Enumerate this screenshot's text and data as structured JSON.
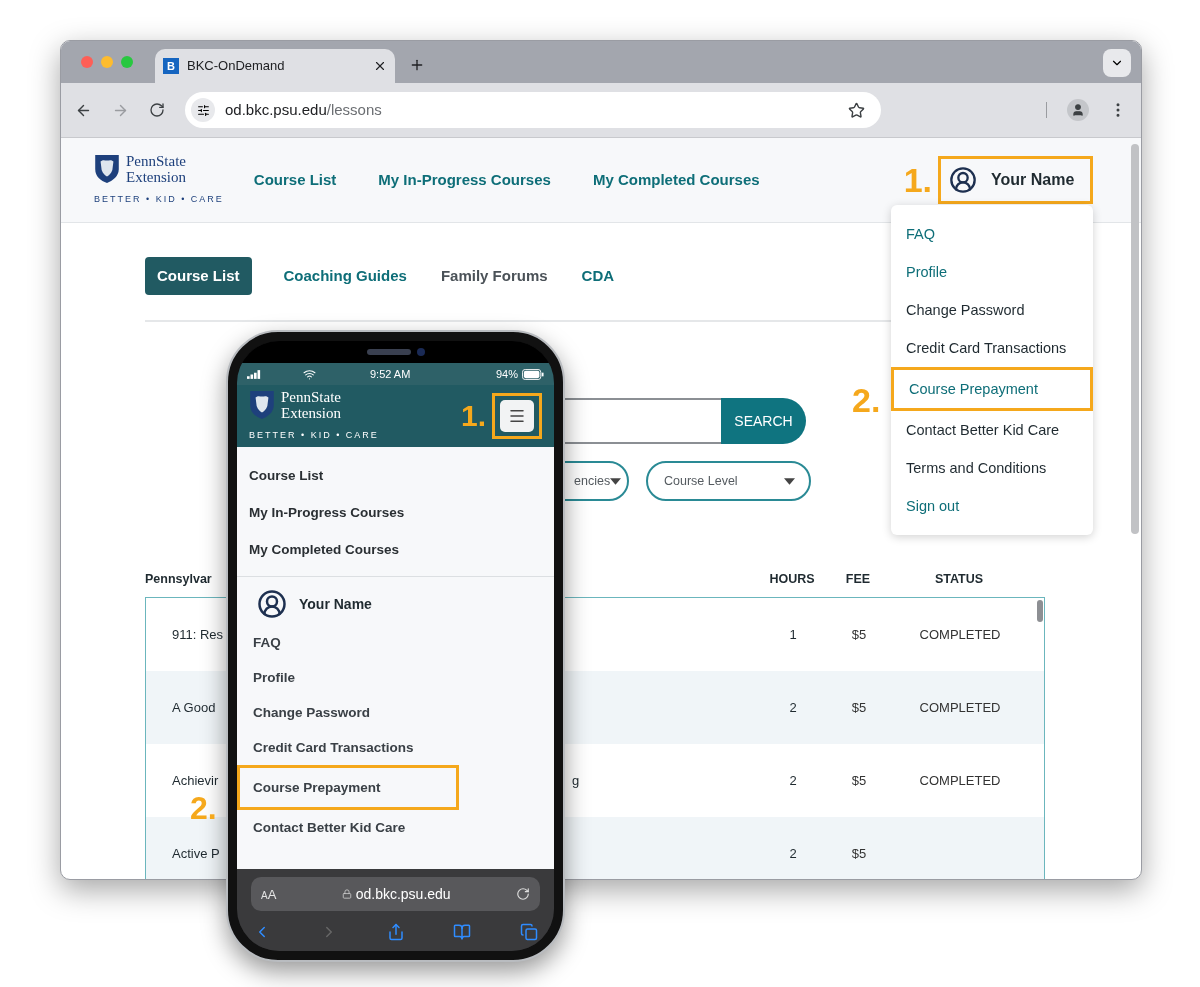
{
  "browser": {
    "tab_title": "BKC-OnDemand",
    "tab_icon_letter": "B",
    "url": {
      "host": "od.bkc.psu.edu",
      "path": "/lessons"
    }
  },
  "site": {
    "logo": {
      "line1": "PennState",
      "line2": "Extension",
      "tagline": "BETTER • KID • CARE"
    },
    "nav": [
      {
        "label": "Course List"
      },
      {
        "label": "My In-Progress Courses"
      },
      {
        "label": "My Completed Courses"
      }
    ],
    "user": {
      "name": "Your Name",
      "callout": "1."
    },
    "user_menu": [
      {
        "label": "FAQ",
        "kind": "link",
        "highlighted": false
      },
      {
        "label": "Profile",
        "kind": "link",
        "highlighted": false
      },
      {
        "label": "Change Password",
        "kind": "text",
        "highlighted": false
      },
      {
        "label": "Credit Card Transactions",
        "kind": "text",
        "highlighted": false
      },
      {
        "label": "Course Prepayment",
        "kind": "link",
        "highlighted": true
      },
      {
        "label": "Contact Better Kid Care",
        "kind": "text",
        "highlighted": false
      },
      {
        "label": "Terms and Conditions",
        "kind": "text",
        "highlighted": false
      },
      {
        "label": "Sign out",
        "kind": "link",
        "highlighted": false
      }
    ],
    "menu_callout": "2.",
    "tabs": [
      {
        "label": "Course List",
        "selected": true,
        "muted": false
      },
      {
        "label": "Coaching Guides",
        "selected": false,
        "muted": false
      },
      {
        "label": "Family Forums",
        "selected": false,
        "muted": true
      },
      {
        "label": "CDA",
        "selected": false,
        "muted": false
      }
    ],
    "search": {
      "button": "SEARCH"
    },
    "filters": [
      {
        "label": "encies"
      },
      {
        "label": "Course Level"
      }
    ],
    "table": {
      "label": "Pennsylvar",
      "columns": [
        "HOURS",
        "FEE",
        "STATUS"
      ],
      "rows": [
        {
          "title": "911: Res",
          "title_end": "",
          "hours": "1",
          "fee": "$5",
          "status": "COMPLETED"
        },
        {
          "title": "A Good",
          "title_end": "",
          "hours": "2",
          "fee": "$5",
          "status": "COMPLETED"
        },
        {
          "title": "Achievir",
          "title_end": "g",
          "hours": "2",
          "fee": "$5",
          "status": "COMPLETED"
        },
        {
          "title": "Active P",
          "title_end": "",
          "hours": "2",
          "fee": "$5",
          "status": ""
        }
      ]
    }
  },
  "phone": {
    "time": "9:52 AM",
    "battery": "94%",
    "logo": {
      "line1": "PennState",
      "line2": "Extension",
      "tagline": "BETTER • KID • CARE"
    },
    "menu_callout": "1.",
    "nav": [
      {
        "label": "Course List"
      },
      {
        "label": "My In-Progress Courses"
      },
      {
        "label": "My Completed Courses"
      }
    ],
    "user": "Your Name",
    "user_menu": [
      {
        "label": "FAQ",
        "highlighted": false
      },
      {
        "label": "Profile",
        "highlighted": false
      },
      {
        "label": "Change Password",
        "highlighted": false
      },
      {
        "label": "Credit Card Transactions",
        "highlighted": false
      },
      {
        "label": "Course Prepayment",
        "highlighted": true
      },
      {
        "label": "Contact Better Kid Care",
        "highlighted": false
      }
    ],
    "item_callout": "2.",
    "text_size": {
      "small": "A",
      "large": "A"
    },
    "url": "od.bkc.psu.edu"
  }
}
